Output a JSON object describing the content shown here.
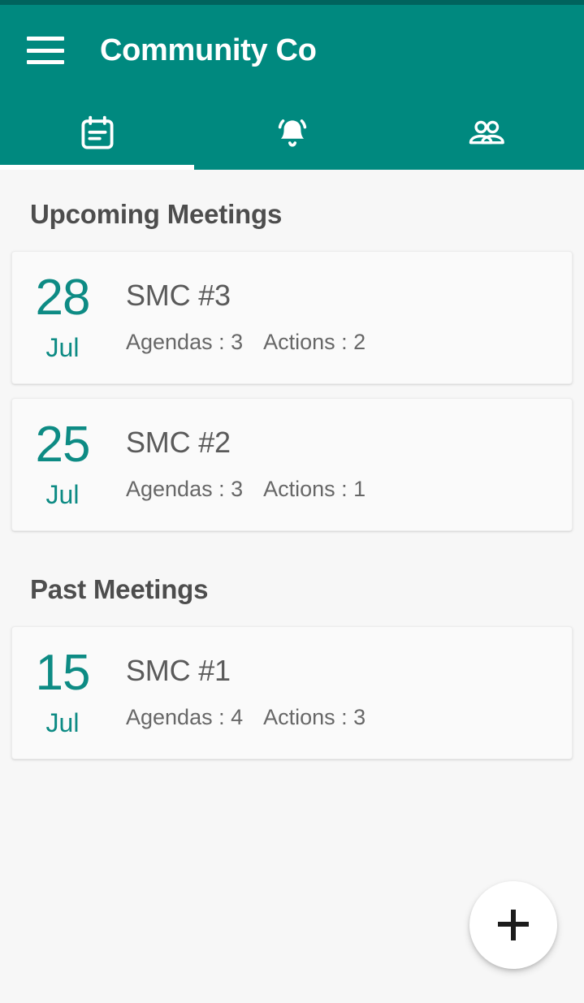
{
  "theme": {
    "primary": "#00897f",
    "primary_dark": "#00635d",
    "accent_teal": "#0d8b84",
    "background": "#f7f7f7",
    "card_background": "#fafafa",
    "heading_text": "#4d4d4d",
    "body_text": "#5a5a5a",
    "fab_background": "#ffffff",
    "fab_icon": "#1c1c1c"
  },
  "appbar": {
    "title": "Community Co",
    "menu_icon": "hamburger-menu-icon"
  },
  "tabs": [
    {
      "id": "meetings",
      "icon": "calendar-event-icon",
      "selected": true
    },
    {
      "id": "notifications",
      "icon": "bell-ringing-icon",
      "selected": false
    },
    {
      "id": "members",
      "icon": "people-group-icon",
      "selected": false
    }
  ],
  "sections": [
    {
      "title": "Upcoming Meetings",
      "meetings": [
        {
          "day": "28",
          "month": "Jul",
          "name": "SMC #3",
          "agendas_label": "Agendas : 3",
          "actions_label": "Actions : 2"
        },
        {
          "day": "25",
          "month": "Jul",
          "name": "SMC #2",
          "agendas_label": "Agendas : 3",
          "actions_label": "Actions : 1"
        }
      ]
    },
    {
      "title": "Past Meetings",
      "meetings": [
        {
          "day": "15",
          "month": "Jul",
          "name": "SMC #1",
          "agendas_label": "Agendas : 4",
          "actions_label": "Actions : 3"
        }
      ]
    }
  ],
  "fab": {
    "icon": "plus-icon",
    "label": "+"
  }
}
